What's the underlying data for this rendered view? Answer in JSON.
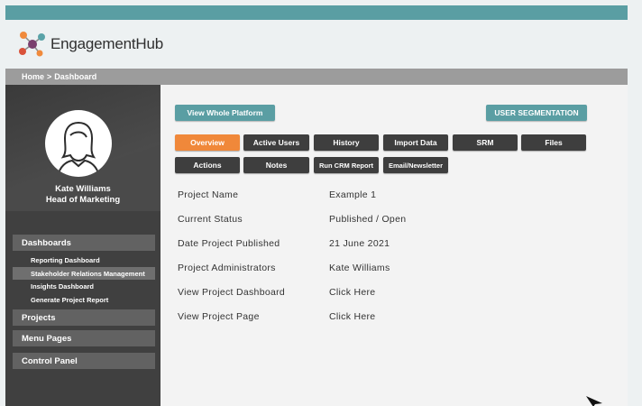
{
  "brand": {
    "name": "EngagementHub",
    "logo_colors": [
      "#f08a3c",
      "#5aa3a8",
      "#d9523a",
      "#7b3f6e",
      "#3b3b3b"
    ]
  },
  "breadcrumb": {
    "home": "Home",
    "separator": ">",
    "current": "Dashboard"
  },
  "user": {
    "name": "Kate Williams",
    "title": "Head of Marketing"
  },
  "sidebar": {
    "sections": [
      {
        "label": "Dashboards"
      },
      {
        "label": "Projects"
      },
      {
        "label": "Menu Pages"
      },
      {
        "label": "Control Panel"
      }
    ],
    "dashboard_items": [
      {
        "label": "Reporting Dashboard",
        "active": false
      },
      {
        "label": "Stakeholder Relations Management",
        "active": true
      },
      {
        "label": "Insights Dashboard",
        "active": false
      },
      {
        "label": "Generate Project Report",
        "active": false
      }
    ]
  },
  "actions": {
    "view_platform": "View Whole Platform",
    "user_segmentation": "USER SEGMENTATION"
  },
  "tabs": [
    {
      "label": "Overview",
      "active": true
    },
    {
      "label": "Active Users",
      "active": false
    },
    {
      "label": "History",
      "active": false
    },
    {
      "label": "Import Data",
      "active": false
    },
    {
      "label": "SRM",
      "active": false
    },
    {
      "label": "Files",
      "active": false
    },
    {
      "label": "Actions",
      "active": false
    },
    {
      "label": "Notes",
      "active": false
    },
    {
      "label": "Run CRM Report",
      "active": false
    },
    {
      "label": "Email/Newsletter",
      "active": false
    }
  ],
  "project_info": [
    {
      "label": "Project Name",
      "value": "Example 1"
    },
    {
      "label": "Current Status",
      "value": "Published / Open"
    },
    {
      "label": "Date Project Published",
      "value": "21 June 2021"
    },
    {
      "label": "Project Administrators",
      "value": "Kate Williams"
    },
    {
      "label": "View Project Dashboard",
      "value": "Click Here"
    },
    {
      "label": "View Project Page",
      "value": "Click Here"
    }
  ],
  "colors": {
    "accent_teal": "#5a9ea3",
    "active_tab": "#f0883a",
    "tab_dark": "#3e3e3e",
    "sidebar": "#404040"
  }
}
